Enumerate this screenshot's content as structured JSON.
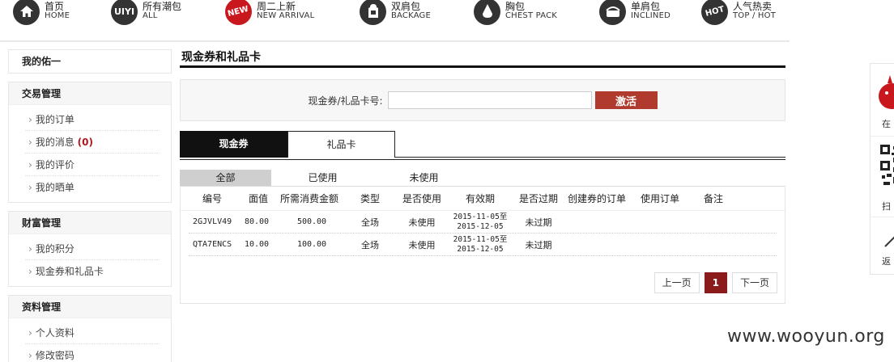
{
  "nav": [
    {
      "cn": "首页",
      "en": "HOME",
      "icon": "home-icon"
    },
    {
      "cn": "所有潮包",
      "en": "ALL",
      "icon": "uiyi-logo-icon",
      "icon_text": "UIYI"
    },
    {
      "cn": "周二上新",
      "en": "NEW ARRIVAL",
      "icon": "new-badge-icon",
      "icon_text": "NEW"
    },
    {
      "cn": "双肩包",
      "en": "BACKAGE",
      "icon": "backpack-icon"
    },
    {
      "cn": "胸包",
      "en": "CHEST PACK",
      "icon": "chest-pack-icon"
    },
    {
      "cn": "单肩包",
      "en": "INCLINED",
      "icon": "shoulder-bag-icon"
    },
    {
      "cn": "人气热卖",
      "en": "TOP / HOT",
      "icon": "hot-badge-icon",
      "icon_text": "HOT"
    }
  ],
  "sidebar": {
    "sections": [
      {
        "title": "我的佑一",
        "items": []
      },
      {
        "title": "交易管理",
        "items": [
          {
            "label": "我的订单"
          },
          {
            "label": "我的消息",
            "count": "(0)"
          },
          {
            "label": "我的评价"
          },
          {
            "label": "我的晒单"
          }
        ]
      },
      {
        "title": "财富管理",
        "items": [
          {
            "label": "我的积分"
          },
          {
            "label": "现金券和礼品卡"
          }
        ]
      },
      {
        "title": "资料管理",
        "items": [
          {
            "label": "个人资料"
          },
          {
            "label": "修改密码"
          }
        ]
      }
    ]
  },
  "main": {
    "title": "现金券和礼品卡",
    "activate": {
      "label": "现金券/礼品卡号:",
      "input_value": "",
      "button_label": "激活"
    },
    "tabs": [
      {
        "label": "现金券",
        "active": true
      },
      {
        "label": "礼品卡",
        "active": false
      }
    ],
    "subtabs": [
      {
        "label": "全部",
        "active": true
      },
      {
        "label": "已使用",
        "active": false
      },
      {
        "label": "未使用",
        "active": false
      }
    ],
    "table": {
      "headers": [
        "编号",
        "面值",
        "所需消费金额",
        "类型",
        "是否使用",
        "有效期",
        "是否过期",
        "创建券的订单",
        "使用订单",
        "备注"
      ],
      "rows": [
        {
          "code": "2GJVLV49",
          "value": "80.00",
          "min": "500.00",
          "type": "全场",
          "used": "未使用",
          "valid_from": "2015-11-05至",
          "valid_to": "2015-12-05",
          "expired": "未过期",
          "create_order": "",
          "use_order": "",
          "note": ""
        },
        {
          "code": "QTA7ENCS",
          "value": "10.00",
          "min": "100.00",
          "type": "全场",
          "used": "未使用",
          "valid_from": "2015-11-05至",
          "valid_to": "2015-12-05",
          "expired": "未过期",
          "create_order": "",
          "use_order": "",
          "note": ""
        }
      ]
    },
    "pager": {
      "prev": "上一页",
      "current": "1",
      "next": "下一页"
    }
  },
  "right_panel": {
    "items": [
      {
        "label": "在",
        "icon": "mascot-icon"
      },
      {
        "label": "扫",
        "icon": "qr-code-icon"
      },
      {
        "label": "返",
        "icon": "back-arrow-icon"
      }
    ]
  },
  "watermark": "www.wooyun.org",
  "colors": {
    "accent": "#b03a2e",
    "pager_current": "#8b1a1a",
    "nav_red": "#c8181e"
  }
}
